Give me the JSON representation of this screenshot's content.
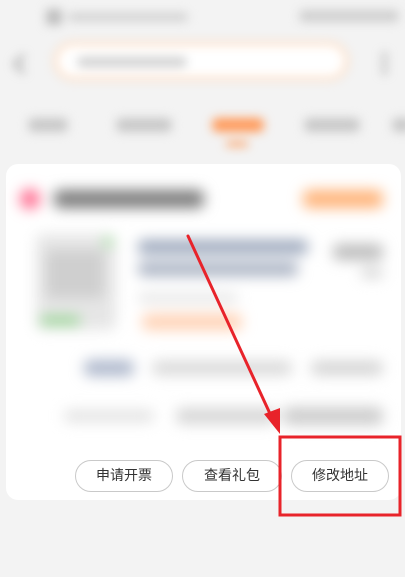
{
  "actions": {
    "invoice_label": "申请开票",
    "gift_label": "查看礼包",
    "address_label": "修改地址"
  },
  "colors": {
    "accent": "#ff8a3d",
    "annotation": "#e8232a",
    "search_border": "#ffd3b0"
  },
  "icons": {
    "back": "back-arrow-icon",
    "more": "more-vertical-icon"
  }
}
